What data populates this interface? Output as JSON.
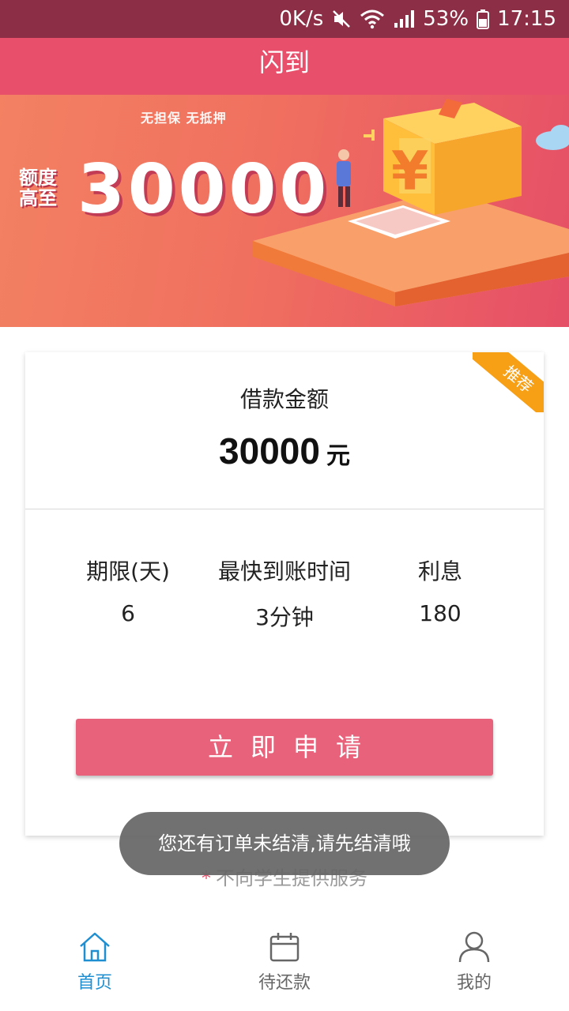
{
  "status_bar": {
    "speed": "0K/s",
    "battery": "53%",
    "time": "17:15"
  },
  "header": {
    "title": "闪到"
  },
  "banner": {
    "subtitle": "无担保  无抵押",
    "lead_top": "额度",
    "lead_bottom": "高至",
    "amount": "30000"
  },
  "card": {
    "badge": "推荐",
    "loan_label": "借款金额",
    "loan_amount": "30000",
    "loan_unit": "元",
    "term_label": "期限(天)",
    "term_value": "6",
    "time_label": "最快到账时间",
    "time_value": "3分钟",
    "interest_label": "利息",
    "interest_value": "180",
    "apply_label": "立即申请"
  },
  "notice": {
    "star": "*",
    "text": "不向学生提供服务"
  },
  "toast": {
    "message": "您还有订单未结清,请先结清哦"
  },
  "bottom_nav": {
    "items": [
      {
        "label": "首页",
        "icon": "home-icon",
        "active": true
      },
      {
        "label": "待还款",
        "icon": "calendar-icon",
        "active": false
      },
      {
        "label": "我的",
        "icon": "user-icon",
        "active": false
      }
    ]
  },
  "colors": {
    "status_bar": "#8b2e46",
    "header": "#e84f6b",
    "apply_button": "#e8627b",
    "badge": "#f7a016",
    "nav_active": "#1f8fd1"
  }
}
